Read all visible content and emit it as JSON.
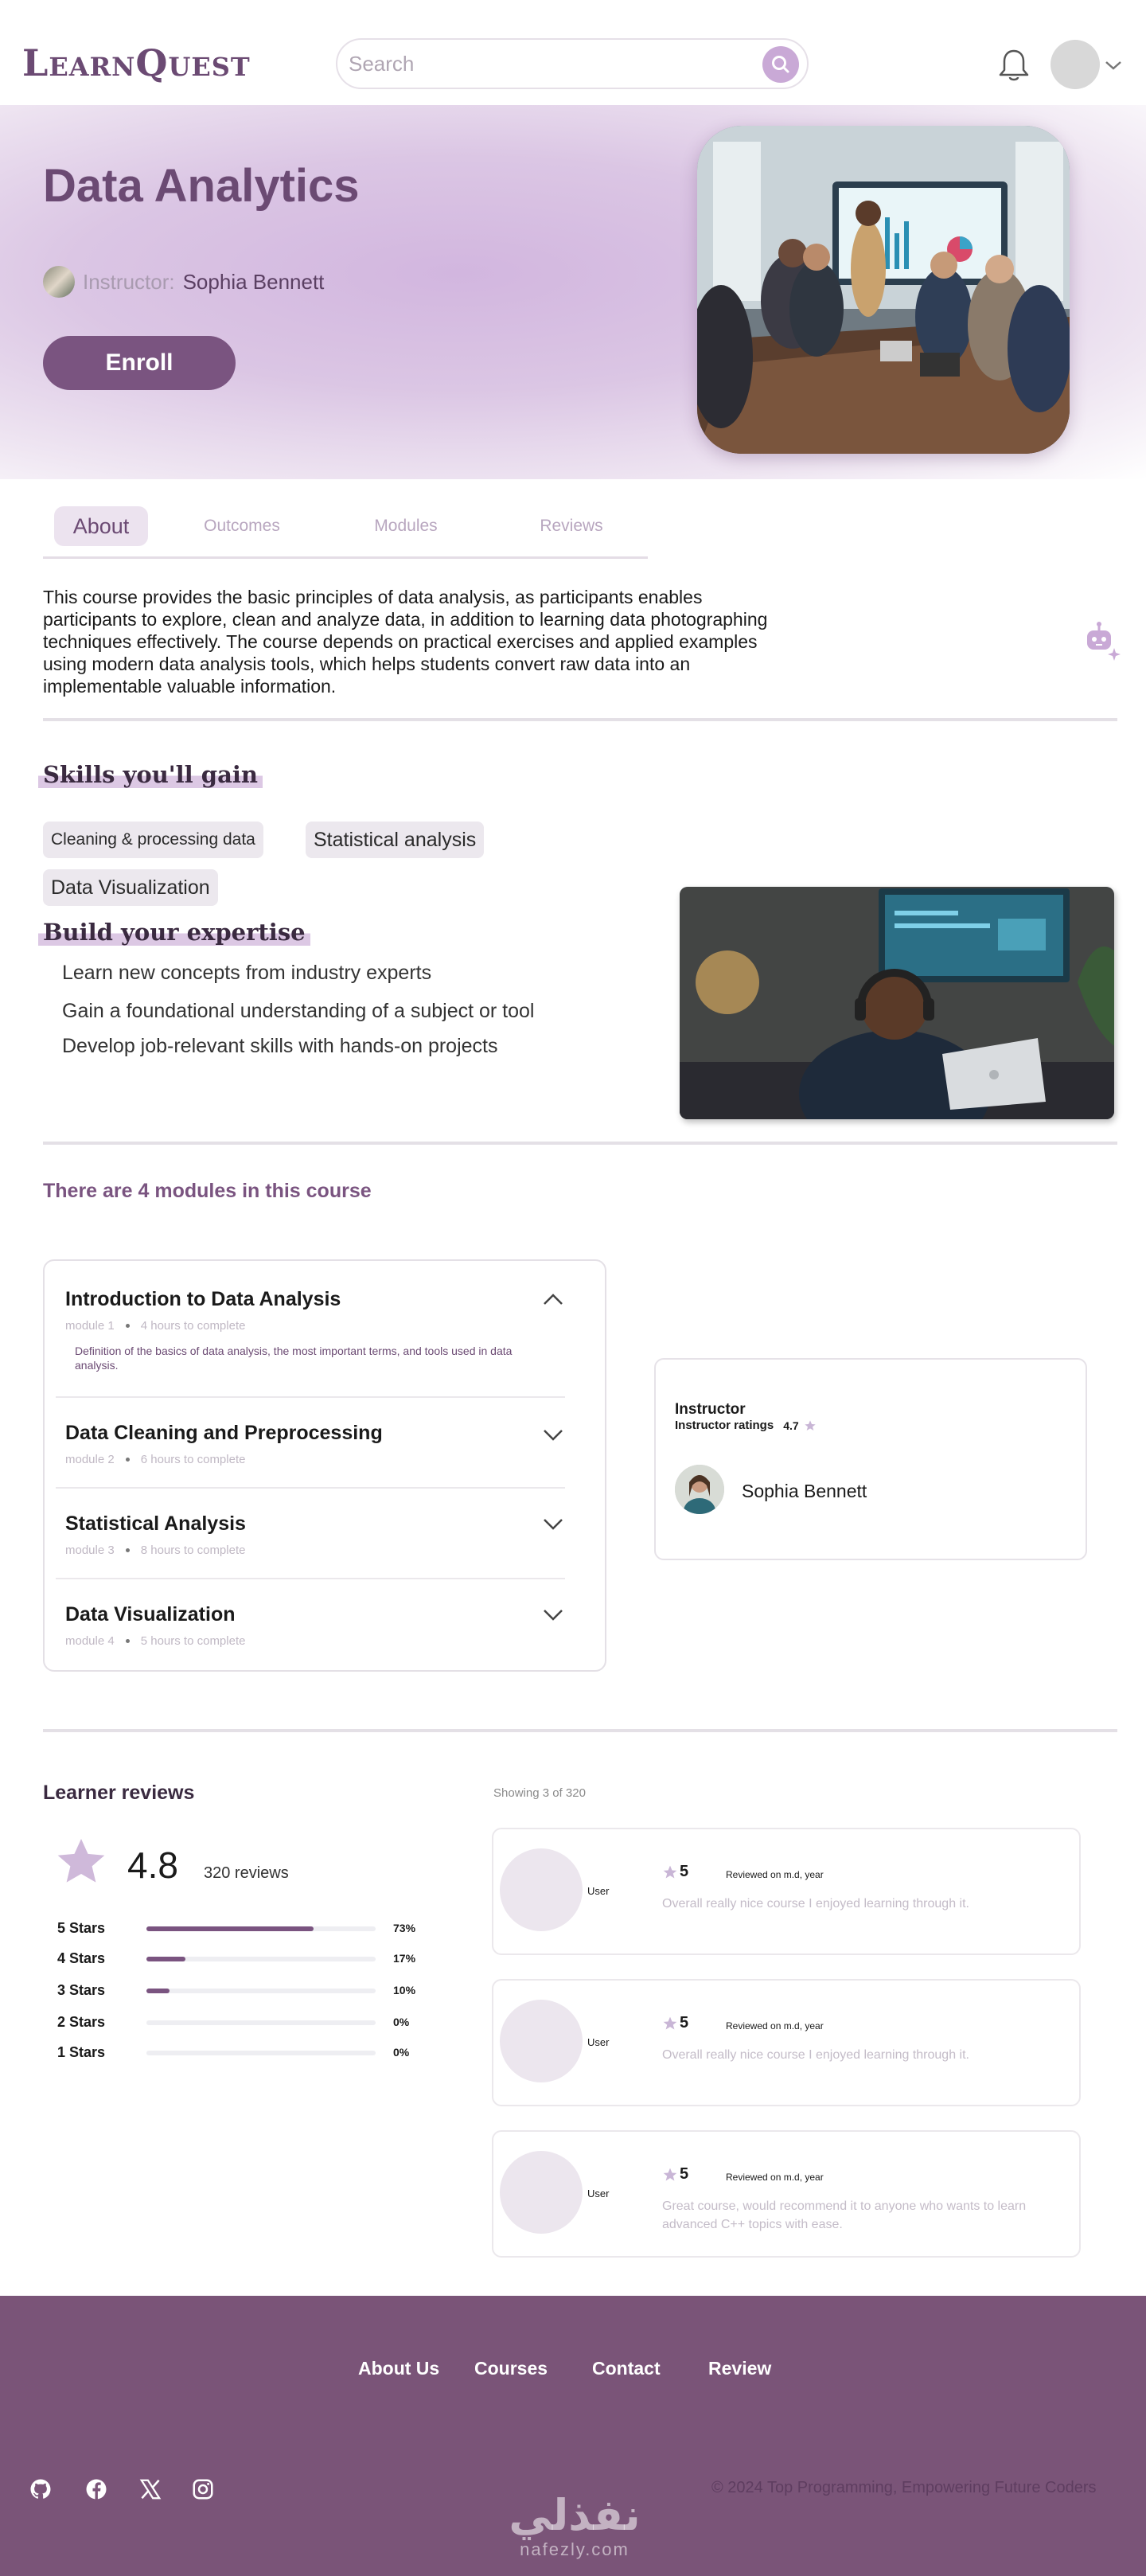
{
  "header": {
    "logo": "LearnQuest",
    "search_placeholder": "Search"
  },
  "hero": {
    "title": "Data Analytics",
    "instructor_prefix": "Instructor:",
    "instructor_name": "Sophia Bennett",
    "enroll_label": "Enroll"
  },
  "tabs": [
    {
      "label": "About",
      "active": true
    },
    {
      "label": "Outcomes",
      "active": false
    },
    {
      "label": "Modules",
      "active": false
    },
    {
      "label": "Reviews",
      "active": false
    }
  ],
  "about": {
    "text": "This course provides the basic principles of data analysis, as participants enables participants to explore, clean and analyze data, in addition to learning data photographing techniques effectively. The course depends on practical exercises and applied examples using modern data analysis tools, which helps students convert raw data into an implementable valuable information."
  },
  "skills": {
    "heading": "Skills you'll gain",
    "items": [
      "Cleaning & processing data",
      "Statistical analysis",
      "Data Visualization"
    ]
  },
  "expertise": {
    "heading": "Build your expertise",
    "items": [
      "Learn new concepts from industry experts",
      "Gain a foundational understanding of a subject or tool",
      "Develop job-relevant skills with hands-on projects"
    ]
  },
  "modules": {
    "heading": "There are 4 modules in this course",
    "items": [
      {
        "title": "Introduction to Data Analysis",
        "number": "module 1",
        "duration": "4 hours to complete",
        "expanded": true,
        "description": "Definition of the basics of data analysis, the most important terms, and tools used in data analysis."
      },
      {
        "title": "Data Cleaning and Preprocessing",
        "number": "module 2",
        "duration": "6 hours to complete",
        "expanded": false,
        "description": ""
      },
      {
        "title": "Statistical Analysis",
        "number": "module 3",
        "duration": "8 hours to complete",
        "expanded": false,
        "description": ""
      },
      {
        "title": "Data Visualization",
        "number": "module 4",
        "duration": "5 hours to complete",
        "expanded": false,
        "description": ""
      }
    ]
  },
  "instructor_card": {
    "title": "Instructor",
    "ratings_label": "Instructor ratings",
    "rating": "4.7",
    "name": "Sophia Bennett"
  },
  "reviews": {
    "heading": "Learner reviews",
    "showing": "Showing 3 of 320",
    "average": "4.8",
    "count": "320 reviews",
    "breakdown": [
      {
        "label": "5 Stars",
        "percent": "73%",
        "value": 73
      },
      {
        "label": "4 Stars",
        "percent": "17%",
        "value": 17
      },
      {
        "label": "3 Stars",
        "percent": "10%",
        "value": 10
      },
      {
        "label": "2 Stars",
        "percent": "0%",
        "value": 0
      },
      {
        "label": "1 Stars",
        "percent": "0%",
        "value": 0
      }
    ],
    "items": [
      {
        "user": "User",
        "score": "5",
        "date": "Reviewed on m.d, year",
        "text": "Overall really nice course I enjoyed learning through it."
      },
      {
        "user": "User",
        "score": "5",
        "date": "Reviewed on m.d, year",
        "text": "Overall really nice course I enjoyed learning through it."
      },
      {
        "user": "User",
        "score": "5",
        "date": "Reviewed on m.d, year",
        "text": "Great course, would recommend it to anyone who wants to learn advanced C++ topics with ease."
      }
    ]
  },
  "footer": {
    "links": [
      "About Us",
      "Courses",
      "Contact",
      "Review"
    ],
    "copyright": "© 2024 Top Programming, Empowering Future Coders",
    "social_icons": [
      "github-icon",
      "facebook-icon",
      "x-icon",
      "instagram-icon"
    ]
  },
  "watermark": {
    "arabic": "نفذلي",
    "latin": "nafezly.com"
  },
  "colors": {
    "brand": "#6b4a73",
    "accent": "#7a5480",
    "footer": "#7a5478",
    "search_button": "#c9a9d6"
  }
}
